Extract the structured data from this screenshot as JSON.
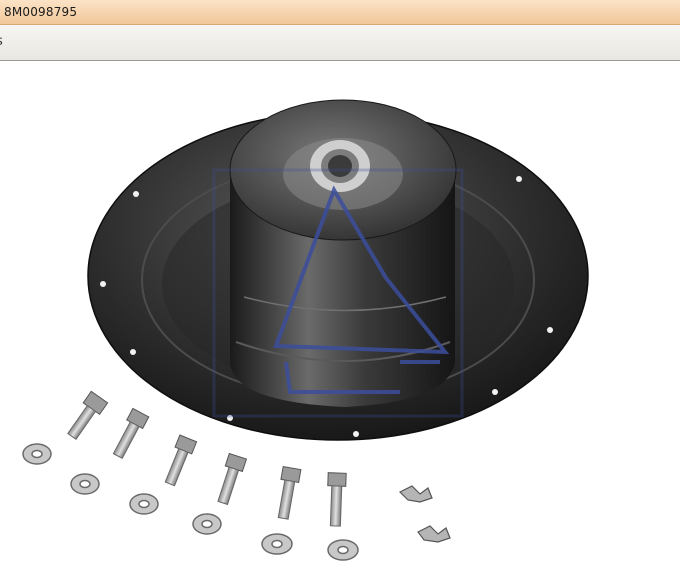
{
  "window": {
    "title": "8M0098795"
  },
  "toolbar": {
    "clipped_label": "s"
  },
  "product_image": {
    "subject": "drive-plate-coupling-kit",
    "parts": [
      "coupling-plate",
      "bolts",
      "washers",
      "clips"
    ],
    "colors": {
      "plate": "#2b2b2b",
      "hub": "#3a3a3a",
      "metal": "#b9b9b9",
      "watermark": "#3b4e9c"
    }
  }
}
